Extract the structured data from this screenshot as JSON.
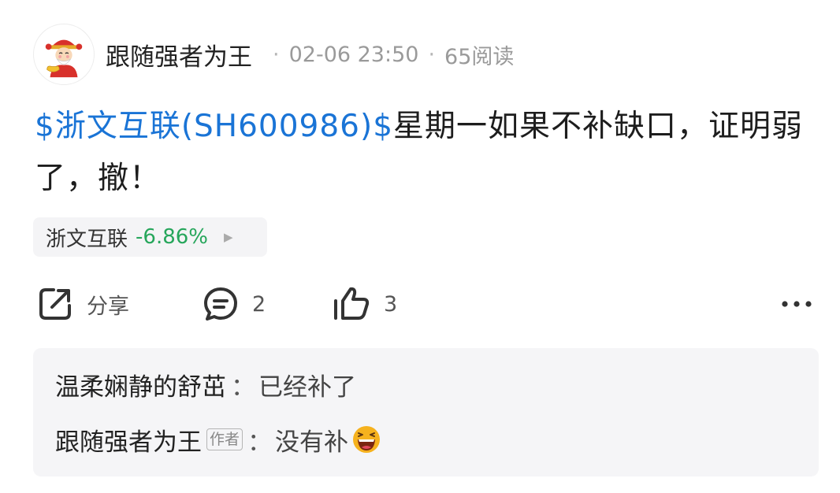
{
  "post": {
    "author": "跟随强者为王",
    "separator": "·",
    "date": "02-06 23:50",
    "views": "65阅读",
    "stock_tag": "$浙文互联(SH600986)$",
    "content": "星期一如果不补缺口，证明弱了，撤！"
  },
  "stock_chip": {
    "name": "浙文互联",
    "change": "-6.86%",
    "arrow": "▶",
    "change_color": "#26a65b"
  },
  "actions": {
    "share_label": "分享",
    "comment_count": "2",
    "like_count": "3",
    "icons": [
      "share-icon",
      "comment-icon",
      "thumbs-up-icon",
      "more-icon"
    ]
  },
  "comments": [
    {
      "user": "温柔娴静的舒茁",
      "colon": "：",
      "text": "已经补了"
    },
    {
      "user": "跟随强者为王",
      "tag": "作者",
      "colon": "：",
      "text": "没有补",
      "emoji": "laughing-emoji-icon"
    }
  ],
  "colors": {
    "link": "#1a74d6",
    "down": "#26a65b",
    "muted": "#9a9a9a"
  }
}
